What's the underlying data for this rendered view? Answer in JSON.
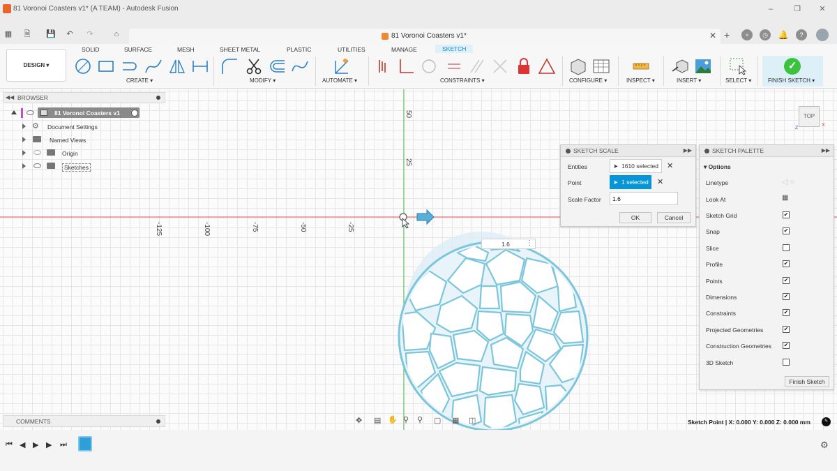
{
  "window": {
    "title": "81 Voronoi Coasters v1* (A TEAM) - Autodesk Fusion"
  },
  "document_tab": {
    "title": "81 Voronoi Coasters v1*"
  },
  "workspace": {
    "label": "DESIGN"
  },
  "ribbon_tabs": [
    "SOLID",
    "SURFACE",
    "MESH",
    "SHEET METAL",
    "PLASTIC",
    "UTILITIES",
    "MANAGE",
    "SKETCH"
  ],
  "active_tab": "SKETCH",
  "ribbon_groups": {
    "create": "CREATE",
    "modify": "MODIFY",
    "automate": "AUTOMATE",
    "constraints": "CONSTRAINTS",
    "configure": "CONFIGURE",
    "inspect": "INSPECT",
    "insert": "INSERT",
    "select": "SELECT",
    "finish": "FINISH SKETCH"
  },
  "browser": {
    "title": "BROWSER",
    "root": "81 Voronoi Coasters v1",
    "items": [
      "Document Settings",
      "Named Views",
      "Origin",
      "Sketches"
    ]
  },
  "rulers": {
    "vertical": [
      "50",
      "25"
    ],
    "horizontal": [
      "-125",
      "-100",
      "-75",
      "-50",
      "-25"
    ]
  },
  "scale_input_value": "1.6",
  "view_cube": {
    "label": "TOP"
  },
  "sketch_scale": {
    "title": "SKETCH SCALE",
    "entities_label": "Entities",
    "entities_value": "1610 selected",
    "point_label": "Point",
    "point_value": "1 selected",
    "scale_factor_label": "Scale Factor",
    "scale_factor_value": "1.6",
    "ok": "OK",
    "cancel": "Cancel"
  },
  "sketch_palette": {
    "title": "SKETCH PALETTE",
    "options_label": "Options",
    "linetype": "Linetype",
    "look_at": "Look At",
    "options": [
      {
        "label": "Sketch Grid",
        "checked": true
      },
      {
        "label": "Snap",
        "checked": true
      },
      {
        "label": "Slice",
        "checked": false
      },
      {
        "label": "Profile",
        "checked": true
      },
      {
        "label": "Points",
        "checked": true
      },
      {
        "label": "Dimensions",
        "checked": true
      },
      {
        "label": "Constraints",
        "checked": true
      },
      {
        "label": "Projected Geometries",
        "checked": true
      },
      {
        "label": "Construction Geometries",
        "checked": true
      },
      {
        "label": "3D Sketch",
        "checked": false
      }
    ],
    "finish_button": "Finish Sketch"
  },
  "comments": {
    "title": "COMMENTS"
  },
  "status_bar": {
    "text": "Sketch Point | X: 0.000 Y: 0.000 Z: 0.000 mm"
  },
  "colors": {
    "accent": "#0696d7",
    "sketch_geometry": "#7cc6dc",
    "x_axis": "#e05050",
    "y_axis": "#4cc04c"
  }
}
